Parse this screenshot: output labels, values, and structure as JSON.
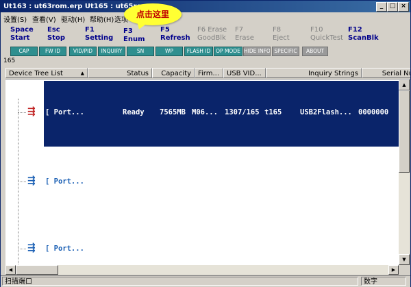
{
  "window": {
    "title": "Ut163 : ut63rom.erp Ut165 : ut65rom.e",
    "min": "_",
    "max": "□",
    "close": "×"
  },
  "menu": {
    "items": [
      "设置(S)",
      "查看(V)",
      "驱动(H)",
      "帮助(H)",
      "选项"
    ]
  },
  "callout": {
    "text": "点击这里"
  },
  "toolbar": {
    "tools": [
      {
        "key": "Space",
        "label": "Start",
        "enabled": true
      },
      {
        "key": "Esc",
        "label": "Stop",
        "enabled": true
      },
      {
        "key": "F1",
        "label": "Setting",
        "enabled": true
      },
      {
        "key": "F3",
        "label": "Enum",
        "enabled": true
      },
      {
        "key": "F5",
        "label": "Refresh",
        "enabled": true
      },
      {
        "key": "F6 Erase",
        "label": "GoodBlk",
        "enabled": false
      },
      {
        "key": "F7",
        "label": "Erase",
        "enabled": false
      },
      {
        "key": "F8",
        "label": "Eject",
        "enabled": false
      },
      {
        "key": "F10",
        "label": "QuickTest",
        "enabled": false
      },
      {
        "key": "F12",
        "label": "ScanBlk",
        "enabled": true
      }
    ]
  },
  "filters": [
    {
      "label": "CAP",
      "enabled": true
    },
    {
      "label": "FW ID",
      "enabled": true
    },
    {
      "label": "VID/PID",
      "enabled": true
    },
    {
      "label": "INQUIRY",
      "enabled": true
    },
    {
      "label": "SN",
      "enabled": true
    },
    {
      "label": "WP",
      "enabled": true
    },
    {
      "label": "FLASH ID",
      "enabled": true
    },
    {
      "label": "OP MODE",
      "enabled": true
    },
    {
      "label": "HIDE INFO",
      "enabled": false
    },
    {
      "label": "SPECIFIC",
      "enabled": false
    },
    {
      "label": "ABOUT",
      "enabled": false
    }
  ],
  "count": "165",
  "columns": [
    "Device Tree List",
    "Status",
    "Capacity",
    "Firm...",
    "USB VID...",
    "Inquiry Strings",
    "Serial Nu"
  ],
  "rows": [
    {
      "port": "[ Port...",
      "status": "Ready",
      "capacity": "7565MB",
      "firm": "M06...",
      "usbvid": "1307/165",
      "vid_tail": "t165",
      "inquiry": "USB2Flash...",
      "serial": "0000000",
      "selected": true
    },
    {
      "port": "[ Port...",
      "status": "",
      "capacity": "",
      "firm": "",
      "usbvid": "",
      "vid_tail": "",
      "inquiry": "",
      "serial": "",
      "selected": false
    },
    {
      "port": "[ Port...",
      "status": "",
      "capacity": "",
      "firm": "",
      "usbvid": "",
      "vid_tail": "",
      "inquiry": "",
      "serial": "",
      "selected": false
    }
  ],
  "status_bar": {
    "left": "扫描端口",
    "right": "数字"
  },
  "colors": {
    "selection": "#0a246a",
    "title_start": "#0a246a",
    "toolbar_text": "#00008b",
    "filter_button": "#2f8f8f",
    "callout_bg": "#ffff33",
    "callout_text": "#c00000"
  },
  "icons": {
    "device": "usb-icon",
    "sort": "sort-arrow-icon"
  }
}
